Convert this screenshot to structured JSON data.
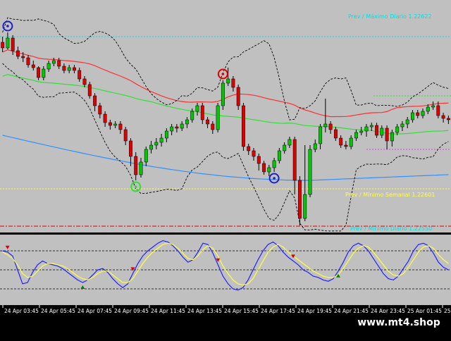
{
  "colors": {
    "background": "#c0c0c0",
    "bull": "#00c800",
    "bear": "#e00000",
    "bollinger": "#000000",
    "ma_red": "#ff3030",
    "ma_green": "#30e030",
    "ma_blue": "#3090ff",
    "stoch_main": "#2020ff",
    "stoch_signal": "#ffff40",
    "prev_max": "#00e0e0",
    "prev_min": "#ffff40",
    "brand_bg": "#000000",
    "brand_text": "#ffffff"
  },
  "levels": {
    "prev_max_daily_label": "Prev / Máximo Diario 1.22622",
    "prev_min_weekly_label": "Prev / Mínimo Semanal 1.22601",
    "prev_min_daily_label": "Prev / Mínimo Diario 1.22550"
  },
  "brand": {
    "text": "www.mt4.shop"
  },
  "chart_data": [
    {
      "type": "candlestick",
      "title": "",
      "x_labels": [
        "24 Apr 03:45",
        "24 Apr 05:45",
        "24 Apr 07:45",
        "24 Apr 09:45",
        "24 Apr 11:45",
        "24 Apr 13:45",
        "24 Apr 15:45",
        "24 Apr 17:45",
        "24 Apr 19:45",
        "24 Apr 21:45",
        "24 Apr 23:45",
        "25 Apr 01:45",
        "25"
      ],
      "grid": false,
      "candles": [
        [
          60,
          68,
          52,
          74
        ],
        [
          68,
          54,
          46,
          70
        ],
        [
          54,
          72,
          50,
          78
        ],
        [
          72,
          80,
          66,
          84
        ],
        [
          80,
          82,
          74,
          88
        ],
        [
          82,
          92,
          78,
          96
        ],
        [
          92,
          96,
          86,
          100
        ],
        [
          96,
          110,
          94,
          114
        ],
        [
          110,
          98,
          94,
          114
        ],
        [
          98,
          90,
          86,
          102
        ],
        [
          90,
          86,
          82,
          94
        ],
        [
          86,
          94,
          82,
          98
        ],
        [
          94,
          100,
          90,
          104
        ],
        [
          100,
          96,
          92,
          104
        ],
        [
          96,
          100,
          92,
          104
        ],
        [
          100,
          112,
          96,
          116
        ],
        [
          112,
          120,
          108,
          124
        ],
        [
          120,
          136,
          116,
          140
        ],
        [
          136,
          150,
          132,
          158
        ],
        [
          150,
          162,
          146,
          168
        ],
        [
          162,
          174,
          158,
          180
        ],
        [
          174,
          178,
          170,
          184
        ],
        [
          178,
          176,
          172,
          182
        ],
        [
          176,
          184,
          172,
          190
        ],
        [
          184,
          200,
          180,
          206
        ],
        [
          200,
          222,
          196,
          236
        ],
        [
          222,
          248,
          216,
          256
        ],
        [
          248,
          230,
          224,
          252
        ],
        [
          230,
          212,
          208,
          236
        ],
        [
          212,
          206,
          200,
          218
        ],
        [
          206,
          202,
          196,
          212
        ],
        [
          202,
          196,
          190,
          208
        ],
        [
          196,
          186,
          182,
          202
        ],
        [
          186,
          180,
          176,
          192
        ],
        [
          180,
          182,
          176,
          188
        ],
        [
          182,
          176,
          172,
          186
        ],
        [
          176,
          170,
          166,
          182
        ],
        [
          170,
          158,
          154,
          174
        ],
        [
          158,
          150,
          146,
          164
        ],
        [
          150,
          170,
          146,
          176
        ],
        [
          170,
          176,
          166,
          182
        ],
        [
          176,
          184,
          172,
          190
        ],
        [
          184,
          150,
          146,
          188
        ],
        [
          150,
          118,
          114,
          156
        ],
        [
          118,
          112,
          96,
          122
        ],
        [
          112,
          124,
          108,
          130
        ],
        [
          124,
          150,
          120,
          156
        ],
        [
          150,
          208,
          146,
          214
        ],
        [
          208,
          214,
          204,
          220
        ],
        [
          214,
          222,
          210,
          228
        ],
        [
          222,
          232,
          218,
          242
        ],
        [
          232,
          244,
          228,
          248
        ],
        [
          244,
          238,
          234,
          250
        ],
        [
          238,
          228,
          224,
          244
        ],
        [
          228,
          214,
          210,
          232
        ],
        [
          214,
          206,
          202,
          218
        ],
        [
          206,
          198,
          194,
          210
        ],
        [
          198,
          256,
          194,
          276
        ],
        [
          256,
          310,
          250,
          320
        ],
        [
          310,
          276,
          206,
          314
        ],
        [
          276,
          212,
          206,
          280
        ],
        [
          212,
          204,
          198,
          216
        ],
        [
          204,
          180,
          176,
          212
        ],
        [
          180,
          176,
          140,
          188
        ],
        [
          176,
          184,
          172,
          190
        ],
        [
          184,
          196,
          180,
          200
        ],
        [
          196,
          206,
          192,
          210
        ],
        [
          206,
          208,
          200,
          212
        ],
        [
          208,
          196,
          192,
          212
        ],
        [
          196,
          188,
          184,
          200
        ],
        [
          188,
          186,
          180,
          192
        ],
        [
          186,
          180,
          176,
          194
        ],
        [
          180,
          178,
          174,
          186
        ],
        [
          178,
          192,
          174,
          196
        ],
        [
          192,
          182,
          178,
          196
        ],
        [
          182,
          200,
          178,
          212
        ],
        [
          200,
          188,
          184,
          208
        ],
        [
          188,
          180,
          176,
          192
        ],
        [
          180,
          176,
          172,
          186
        ],
        [
          176,
          170,
          166,
          182
        ],
        [
          170,
          160,
          156,
          174
        ],
        [
          160,
          164,
          156,
          168
        ],
        [
          164,
          158,
          154,
          168
        ],
        [
          158,
          152,
          148,
          162
        ],
        [
          152,
          150,
          144,
          156
        ],
        [
          150,
          164,
          144,
          168
        ],
        [
          164,
          168,
          160,
          174
        ],
        [
          168,
          170,
          164,
          176
        ]
      ],
      "markers": [
        {
          "kind": "high",
          "index": 1
        },
        {
          "kind": "high",
          "index": 43
        },
        {
          "kind": "low",
          "index": 26
        },
        {
          "kind": "low",
          "index": 53
        }
      ]
    },
    {
      "type": "line",
      "title": "",
      "ylim": [
        0,
        100
      ],
      "series": [
        {
          "name": "",
          "values": [
            80,
            78,
            72,
            50,
            28,
            30,
            46,
            58,
            64,
            60,
            58,
            56,
            52,
            46,
            40,
            34,
            30,
            34,
            42,
            50,
            52,
            46,
            36,
            28,
            22,
            28,
            44,
            60,
            72,
            80,
            86,
            92,
            96,
            94,
            88,
            80,
            70,
            62,
            66,
            78,
            92,
            90,
            76,
            58,
            40,
            28,
            20,
            18,
            22,
            34,
            50,
            66,
            80,
            90,
            94,
            88,
            78,
            70,
            64,
            58,
            50,
            46,
            40,
            38,
            34,
            32,
            36,
            48,
            62,
            78,
            88,
            92,
            88,
            80,
            68,
            56,
            44,
            36,
            34,
            40,
            52,
            64,
            80,
            90,
            92,
            88,
            76,
            62,
            54,
            50
          ]
        },
        {
          "name": "",
          "values": [
            78,
            74,
            68,
            58,
            44,
            38,
            40,
            48,
            56,
            60,
            60,
            58,
            56,
            52,
            46,
            40,
            36,
            34,
            38,
            44,
            48,
            48,
            42,
            36,
            30,
            30,
            36,
            48,
            60,
            70,
            78,
            84,
            90,
            92,
            90,
            84,
            76,
            68,
            66,
            72,
            82,
            88,
            84,
            72,
            56,
            44,
            34,
            28,
            26,
            28,
            36,
            50,
            64,
            78,
            86,
            90,
            86,
            78,
            72,
            66,
            60,
            54,
            48,
            44,
            40,
            38,
            38,
            42,
            52,
            64,
            76,
            84,
            88,
            86,
            78,
            68,
            58,
            48,
            42,
            40,
            44,
            54,
            66,
            78,
            86,
            88,
            84,
            74,
            66,
            60
          ]
        }
      ],
      "levels": [
        80,
        20
      ],
      "markers": [
        {
          "kind": "sell",
          "index": 1
        },
        {
          "kind": "buy",
          "index": 16
        },
        {
          "kind": "sell",
          "index": 26
        },
        {
          "kind": "sell",
          "index": 43
        },
        {
          "kind": "sell",
          "index": 58
        },
        {
          "kind": "buy",
          "index": 67
        }
      ]
    }
  ]
}
